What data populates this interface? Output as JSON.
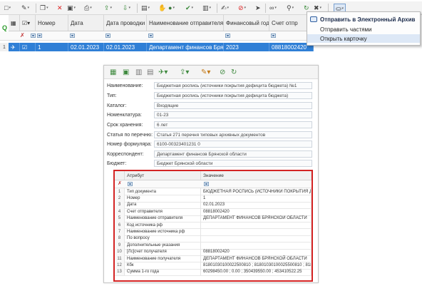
{
  "list": {
    "columns": [
      "Номер",
      "Дата",
      "Дата проводки",
      "Наименование отправителя",
      "Финансовый год",
      "Счет отпр"
    ],
    "row": {
      "index": "1",
      "number": "1",
      "date": "02.01.2023",
      "posting_date": "02.01.2023",
      "sender": "Департамент финансов Брянской",
      "fin_year": "2023",
      "account": "08818002420"
    }
  },
  "popup_menu": {
    "items": [
      "Отправить в Электронный Архив",
      "Отправить частями",
      "Открыть карточку"
    ]
  },
  "card": {
    "fields": [
      {
        "label": "Наименование:",
        "value": "Бюджетная роспись (источники покрытия дефицита бюджета) №1"
      },
      {
        "label": "Тип:",
        "value": "Бюджетная роспись (источники покрытия дефицита бюджета)"
      },
      {
        "label": "Каталог:",
        "value": "Входящие"
      },
      {
        "label": "Номенклатура:",
        "value": "01-23"
      },
      {
        "label": "Срок хранения:",
        "value": "6 лет"
      },
      {
        "label": "Статья по перечню:",
        "value": "Статья 271 перечня типовых архивных документов"
      },
      {
        "label": "Номер формуляра:",
        "value": "6100-00323401231 0"
      },
      {
        "label": "Корреспондент:",
        "value": "Департамент финансов Брянской области"
      },
      {
        "label": "Бюджет:",
        "value": "Бюджет Брянской области"
      }
    ],
    "attributes": {
      "col_attr": "Атрибут",
      "col_value": "Значение",
      "rows": [
        {
          "n": "1",
          "name": "Тип документа",
          "value": "БЮДЖЕТНАЯ РОСПИСЬ (ИСТОЧНИКИ ПОКРЫТИЯ ДЕФ..."
        },
        {
          "n": "2",
          "name": "Номер",
          "value": "1"
        },
        {
          "n": "3",
          "name": "Дата",
          "value": "02.01.2023"
        },
        {
          "n": "4",
          "name": "Счет отправителя",
          "value": "08818002420"
        },
        {
          "n": "5",
          "name": "Наименование отправителя",
          "value": "ДЕПАРТАМЕНТ ФИНАНСОВ БРЯНСКОЙ ОБЛАСТИ"
        },
        {
          "n": "6",
          "name": "Код источника рф",
          "value": ""
        },
        {
          "n": "7",
          "name": "Наименование источника рф",
          "value": ""
        },
        {
          "n": "8",
          "name": "По вопросу",
          "value": ""
        },
        {
          "n": "9",
          "name": "Дополнительные указания",
          "value": ""
        },
        {
          "n": "10",
          "name": "[Лс]счет получателя",
          "value": "08818002420"
        },
        {
          "n": "11",
          "name": "Наименование получателя",
          "value": "ДЕПАРТАМЕНТ ФИНАНСОВ БРЯНСКОЙ ОБЛАСТИ"
        },
        {
          "n": "12",
          "name": "Кбк",
          "value": "81801030100022500810 ; 81801030100025500810 ; 81801..."
        },
        {
          "n": "13",
          "name": "Сумма 1-го года",
          "value": "60298450.00 ; 0.00 ; 350439550.00 ; 453410522.25"
        }
      ]
    }
  }
}
